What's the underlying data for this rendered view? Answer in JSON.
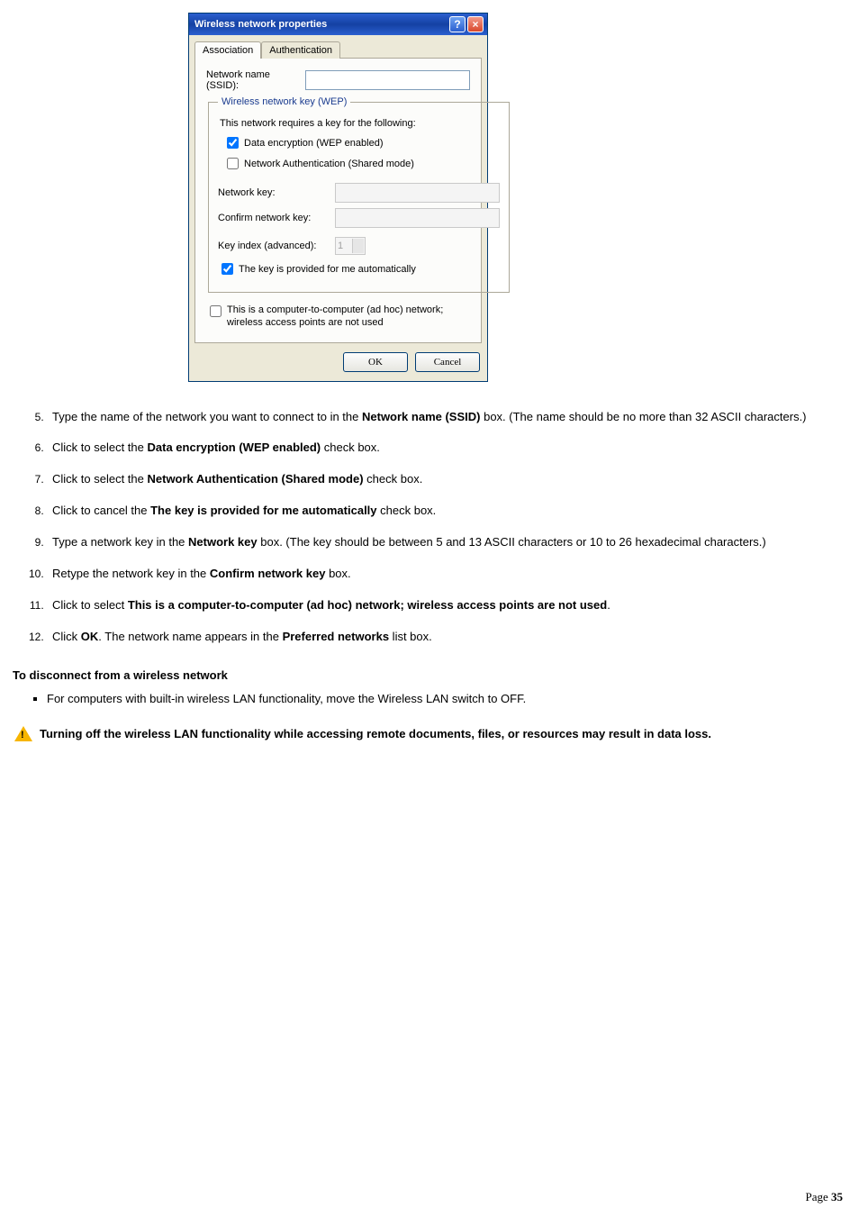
{
  "dialog": {
    "title": "Wireless network properties",
    "tabs": {
      "assoc": "Association",
      "auth": "Authentication"
    },
    "ssid_label": "Network name (SSID):",
    "group_legend": "Wireless network key (WEP)",
    "requires_text": "This network requires a key for the following:",
    "chk_wep": "Data encryption (WEP enabled)",
    "chk_shared": "Network Authentication (Shared mode)",
    "netkey_label": "Network key:",
    "confirm_label": "Confirm network key:",
    "keyindex_label": "Key index (advanced):",
    "keyindex_value": "1",
    "chk_auto": "The key is provided for me automatically",
    "chk_adhoc": "This is a computer-to-computer (ad hoc) network; wireless access points are not used",
    "ok": "OK",
    "cancel": "Cancel"
  },
  "steps": {
    "s5a": "Type the name of the network you want to connect to in the ",
    "s5b": "Network name (SSID)",
    "s5c": " box. (The name should be no more than 32 ASCII characters.)",
    "s6a": "Click to select the ",
    "s6b": "Data encryption (WEP enabled)",
    "s6c": " check box.",
    "s7a": "Click to select the ",
    "s7b": "Network Authentication (Shared mode)",
    "s7c": " check box.",
    "s8a": "Click to cancel the ",
    "s8b": "The key is provided for me automatically",
    "s8c": " check box.",
    "s9a": "Type a network key in the ",
    "s9b": "Network key",
    "s9c": " box. (The key should be between 5 and 13 ASCII characters or 10 to 26 hexadecimal characters.)",
    "s10a": "Retype the network key in the ",
    "s10b": "Confirm network key",
    "s10c": " box.",
    "s11a": "Click to select ",
    "s11b": "This is a computer-to-computer (ad hoc) network; wireless access points are not used",
    "s11c": ".",
    "s12a": "Click ",
    "s12b": "OK",
    "s12c": ". The network name appears in the ",
    "s12d": "Preferred networks",
    "s12e": " list box."
  },
  "disconnect_heading": "To disconnect from a wireless network",
  "disconnect_bullet": "For computers with built-in wireless LAN functionality, move the Wireless LAN switch to OFF.",
  "warning": "Turning off the wireless LAN functionality while accessing remote documents, files, or resources may result in data loss.",
  "page_label": "Page ",
  "page_number": "35"
}
